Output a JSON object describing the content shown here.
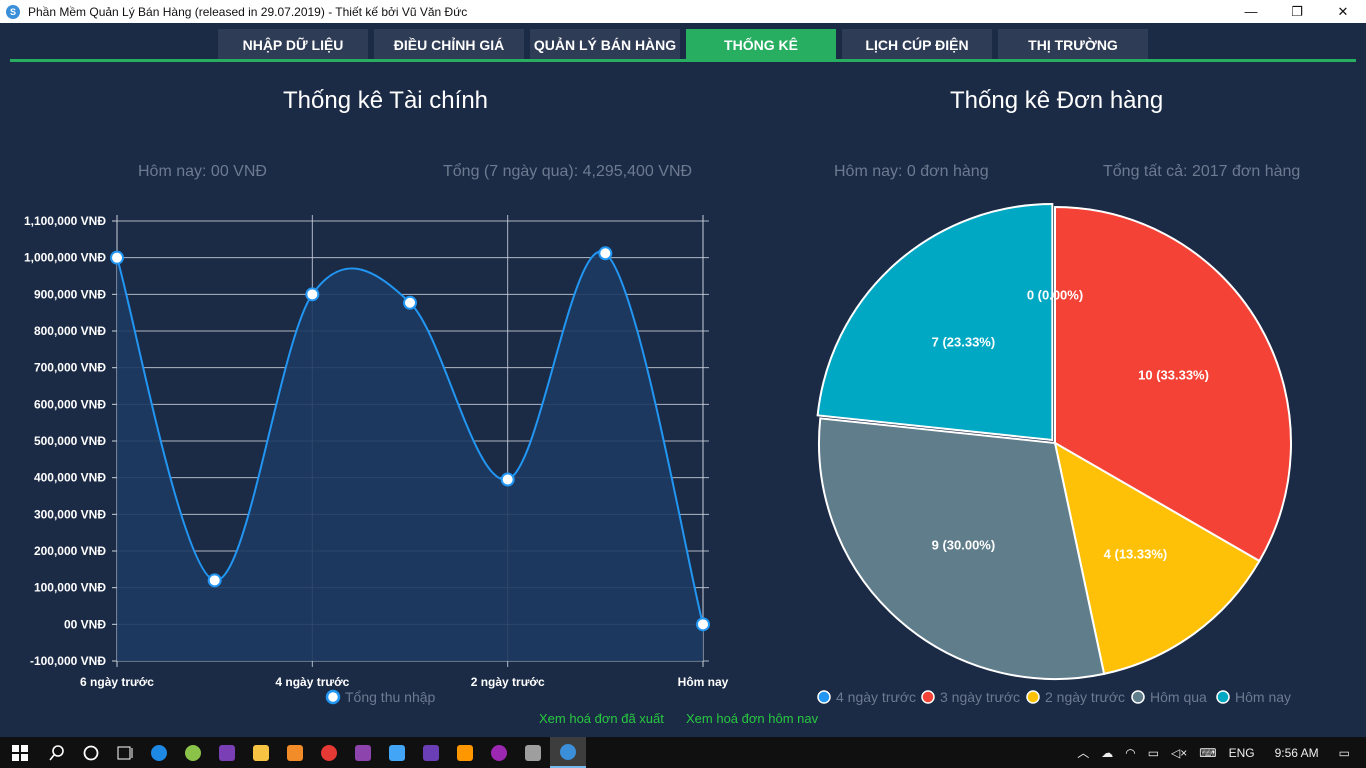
{
  "window": {
    "title": "Phần Mềm Quản Lý Bán Hàng (released in 29.07.2019) - Thiết kế bởi Vũ Văn Đức",
    "app_icon": "S",
    "minimize": "—",
    "maximize": "❐",
    "close": "✕"
  },
  "tabs": [
    {
      "label": "NHẬP DỮ LIỆU",
      "active": false
    },
    {
      "label": "ĐIỀU CHỈNH GIÁ",
      "active": false
    },
    {
      "label": "QUẢN LÝ BÁN HÀNG",
      "active": false
    },
    {
      "label": "THỐNG KÊ",
      "active": true
    },
    {
      "label": "LỊCH CÚP ĐIỆN",
      "active": false
    },
    {
      "label": "THỊ TRƯỜNG",
      "active": false
    }
  ],
  "finance": {
    "title": "Thống kê Tài chính",
    "today": "Hôm nay: 00 VNĐ",
    "total": "Tổng (7 ngày qua): 4,295,400 VNĐ"
  },
  "orders": {
    "title": "Thống kê Đơn hàng",
    "today": "Hôm nay: 0 đơn hàng",
    "total": "Tổng tất cả: 2017 đơn hàng"
  },
  "links": {
    "exported": "Xem hoá đơn đã xuất",
    "today": "Xem hoá đơn hôm nav"
  },
  "colors": {
    "background": "#1b2a45",
    "accent": "#27ae60",
    "line": "#2196f3",
    "area": "#1e3a60"
  },
  "chart_data": [
    {
      "type": "area",
      "x_labels": [
        "6 ngày trước",
        "",
        "4 ngày trước",
        "",
        "2 ngày trước",
        "",
        "Hôm nay"
      ],
      "ytick_labels": [
        "1,100,000 VNĐ",
        "1,000,000 VNĐ",
        "900,000 VNĐ",
        "800,000 VNĐ",
        "700,000 VNĐ",
        "600,000 VNĐ",
        "500,000 VNĐ",
        "400,000 VNĐ",
        "300,000 VNĐ",
        "200,000 VNĐ",
        "100,000 VNĐ",
        "00 VNĐ",
        "-100,000 VNĐ"
      ],
      "ylim": [
        -100000,
        1100000
      ],
      "series": [
        {
          "name": "Tổng thu nhập",
          "values": [
            1000000,
            120000,
            900000,
            877000,
            395000,
            1012000,
            0
          ],
          "color": "#2196f3"
        }
      ],
      "grid": true,
      "legend": "bottom"
    },
    {
      "type": "pie",
      "slices": [
        {
          "name": "4 ngày trước",
          "value": 0,
          "label": "0 (0.00%)",
          "color": "#2196f3"
        },
        {
          "name": "3 ngày trước",
          "value": 10,
          "label": "10 (33.33%)",
          "color": "#f44336"
        },
        {
          "name": "2 ngày trước",
          "value": 4,
          "label": "4 (13.33%)",
          "color": "#ffc107"
        },
        {
          "name": "Hôm qua",
          "value": 9,
          "label": "9 (30.00%)",
          "color": "#607d8b"
        },
        {
          "name": "Hôm nay",
          "value": 7,
          "label": "7 (23.33%)",
          "color": "#00a8c3"
        }
      ],
      "legend": "bottom"
    }
  ],
  "taskbar": {
    "lang": "ENG",
    "time": "9:56 AM",
    "icons": [
      "windows-icon",
      "search-icon",
      "cortana-icon",
      "task-view-icon",
      "edge-icon",
      "app-green-icon",
      "visual-studio-icon",
      "file-explorer-icon",
      "sublime-icon",
      "chrome-icon",
      "vs-purple-icon",
      "app-blue-icon",
      "vs-icon",
      "media-icon",
      "app-purple-icon",
      "app-gray-icon",
      "sales-app-icon"
    ]
  }
}
